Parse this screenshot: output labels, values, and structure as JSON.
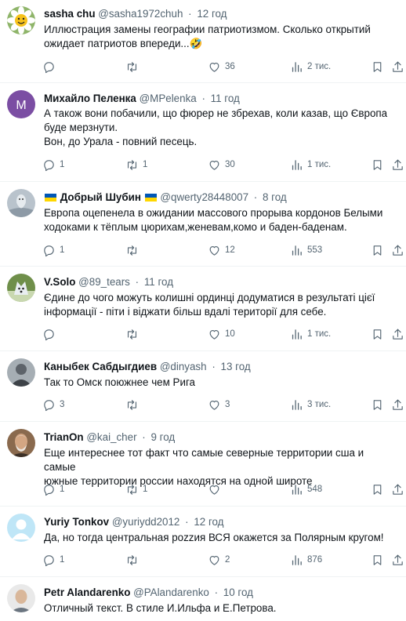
{
  "posts": [
    {
      "name": "sasha chu",
      "handle": "@sasha1972chuh",
      "time": "12 год",
      "lines": [
        "Иллюстрация замены географии патриотизмом. Сколько открытий",
        "ожидает патриотов впереди...🤣"
      ],
      "replies": "",
      "retweets": "",
      "likes": "36",
      "views": "2 тис.",
      "avatar": "daisy-flower-avatar",
      "flag": false
    },
    {
      "name": "Михайло Пеленка",
      "handle": "@MPelenka",
      "time": "11 год",
      "lines": [
        "А також вони побачили, що фюрер не збрехав, коли казав, що Європа",
        "буде мерзнути.",
        "Вон, до Урала - повний песець."
      ],
      "replies": "1",
      "retweets": "1",
      "likes": "30",
      "views": "1 тис.",
      "avatar": "letter-avatar",
      "avatar_letter": "M",
      "avatar_color": "#7b4ea3",
      "flag": false
    },
    {
      "name": "Добрый Шубин",
      "handle": "@qwerty28448007",
      "time": "8 год",
      "lines": [
        "Европа оцепенела в ожидании массового прорыва кордонов Белыми",
        "ходоками к тёплым цюрихам,женевам,комо и баден-баденам."
      ],
      "replies": "1",
      "retweets": "",
      "likes": "12",
      "views": "553",
      "avatar": "ghost-figure-avatar",
      "flag": true,
      "flag_colors": [
        "#0057b7",
        "#ffd700"
      ]
    },
    {
      "name": "V.Solo",
      "handle": "@89_tears",
      "time": "11 год",
      "lines": [
        "Єдине до чого можуть колишні ординці додуматися в результаті цієї",
        "інформації - піти і віджати більш вдалі території для себе."
      ],
      "replies": "",
      "retweets": "",
      "likes": "10",
      "views": "1 тис.",
      "avatar": "fox-avatar",
      "flag": false
    },
    {
      "name": "Каныбек Сабдыгдиев",
      "handle": "@dinyash",
      "time": "13 год",
      "lines": [
        "Так то Омск поюжнее  чем  Рига"
      ],
      "replies": "3",
      "retweets": "",
      "likes": "3",
      "views": "3 тис.",
      "avatar": "man-avatar",
      "flag": false
    },
    {
      "name": "TrianOn",
      "handle": "@kai_cher",
      "time": "9 год",
      "lines": [
        "Еще интереснее тот факт что самые северные территории сша и самые",
        "южные территории россии находятся на одной широте"
      ],
      "replies": "1",
      "retweets": "1",
      "likes": "",
      "views": "548",
      "avatar": "portrait-avatar",
      "flag": false
    },
    {
      "name": "Yuriy Tonkov",
      "handle": "@yuriydd2012",
      "time": "12 год",
      "lines": [
        "Да, но тогда центральная роzzия ВСЯ окажется за Полярным кругом!"
      ],
      "replies": "1",
      "retweets": "",
      "likes": "2",
      "views": "876",
      "avatar": "default-avatar",
      "flag": false
    },
    {
      "name": "Petr Alandarenko",
      "handle": "@PAlandarenko",
      "time": "10 год",
      "lines": [
        "Отличный текст. В стиле И.Ильфа и Е.Петрова."
      ],
      "replies": "",
      "retweets": "",
      "likes": "",
      "views": "",
      "avatar": "bald-man-avatar",
      "flag": false
    }
  ],
  "colors": {
    "text": "#0f1419",
    "secondary": "#536471",
    "divider": "#eff3f4"
  }
}
